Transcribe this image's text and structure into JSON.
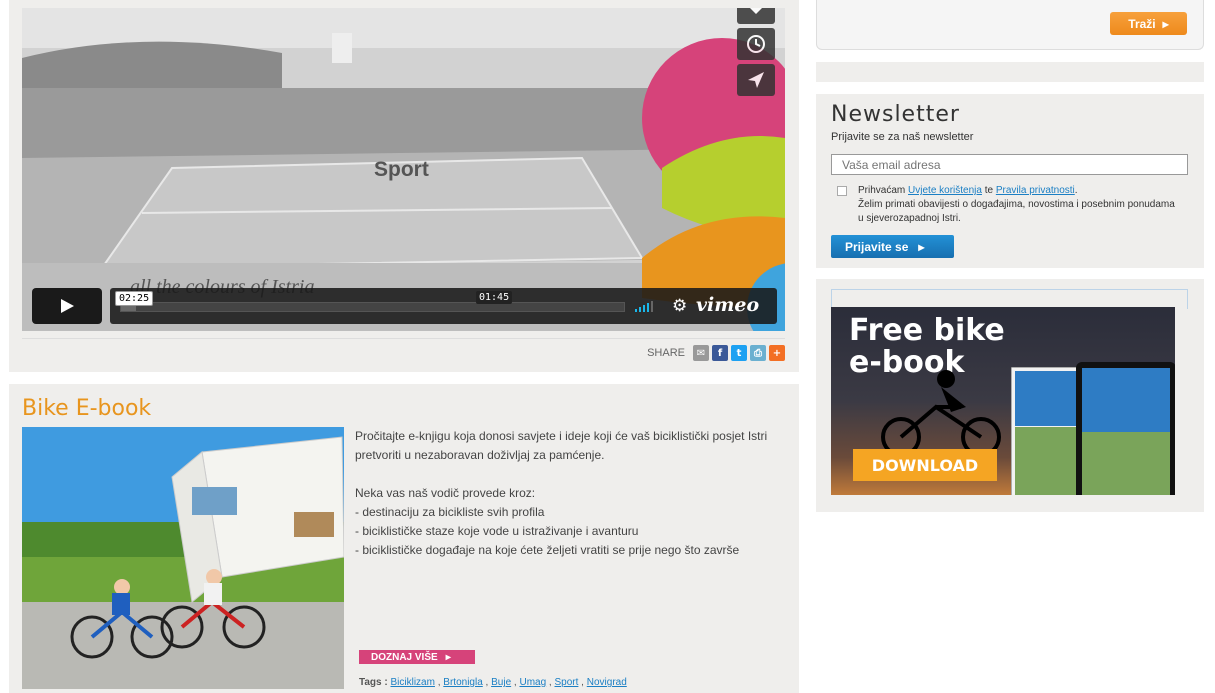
{
  "video": {
    "overlay_word": "Sport",
    "tagline": "all the colours of Istria",
    "elapsed": "02:25",
    "hover_time": "01:45",
    "played_fraction": 0.03,
    "provider": "vimeo",
    "side_icons": [
      "heart-icon",
      "clock-icon",
      "send-icon"
    ]
  },
  "share": {
    "label": "SHARE",
    "icons": [
      "email-icon",
      "facebook-icon",
      "twitter-icon",
      "print-icon",
      "plus-icon"
    ]
  },
  "ebook": {
    "title": "Bike E-book",
    "intro": "Pročitajte e-knjigu koja donosi savjete i ideje koji će vaš biciklistički posjet Istri pretvoriti u nezaboravan doživljaj za pamćenje.",
    "lead": "Neka vas naš vodič provede kroz:",
    "bullets": [
      "- destinaciju za bicikliste svih profila",
      "- biciklističke staze koje vode u istraživanje i avanturu",
      "- biciklističke događaje na koje ćete željeti vratiti se prije nego što završe"
    ],
    "more_label": "DOZNAJ VIŠE",
    "tags_label": "Tags :",
    "tags": [
      "Biciklizam",
      "Brtonigla",
      "Buje",
      "Umag",
      "Sport",
      "Novigrad"
    ]
  },
  "search": {
    "button_label": "Traži"
  },
  "newsletter": {
    "title": "Newsletter",
    "subtitle": "Prijavite se za naš newsletter",
    "email_placeholder": "Vaša email adresa",
    "consent_prefix": "Prihvaćam",
    "terms_link": "Uvjete korištenja",
    "consent_middle": "te",
    "privacy_link": "Pravila privatnosti",
    "consent_suffix": ".",
    "consent_line2": "Želim primati obavijesti o događajima, novostima i posebnim ponudama u sjeverozapadnoj Istri.",
    "submit_label": "Prijavite se"
  },
  "ad": {
    "title_line1": "Free bike",
    "title_line2": "e-book",
    "button_label": "DOWNLOAD"
  },
  "colors": {
    "accent_orange": "#e8951e",
    "link_blue": "#1b7fc4",
    "pink": "#d6437a"
  }
}
